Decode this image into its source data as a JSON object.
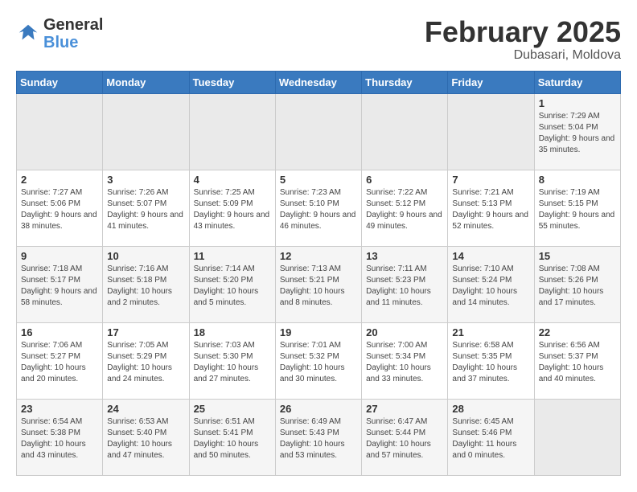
{
  "header": {
    "logo_line1": "General",
    "logo_line2": "Blue",
    "month_year": "February 2025",
    "location": "Dubasari, Moldova"
  },
  "weekdays": [
    "Sunday",
    "Monday",
    "Tuesday",
    "Wednesday",
    "Thursday",
    "Friday",
    "Saturday"
  ],
  "weeks": [
    [
      {
        "day": "",
        "info": ""
      },
      {
        "day": "",
        "info": ""
      },
      {
        "day": "",
        "info": ""
      },
      {
        "day": "",
        "info": ""
      },
      {
        "day": "",
        "info": ""
      },
      {
        "day": "",
        "info": ""
      },
      {
        "day": "1",
        "info": "Sunrise: 7:29 AM\nSunset: 5:04 PM\nDaylight: 9 hours and 35 minutes."
      }
    ],
    [
      {
        "day": "2",
        "info": "Sunrise: 7:27 AM\nSunset: 5:06 PM\nDaylight: 9 hours and 38 minutes."
      },
      {
        "day": "3",
        "info": "Sunrise: 7:26 AM\nSunset: 5:07 PM\nDaylight: 9 hours and 41 minutes."
      },
      {
        "day": "4",
        "info": "Sunrise: 7:25 AM\nSunset: 5:09 PM\nDaylight: 9 hours and 43 minutes."
      },
      {
        "day": "5",
        "info": "Sunrise: 7:23 AM\nSunset: 5:10 PM\nDaylight: 9 hours and 46 minutes."
      },
      {
        "day": "6",
        "info": "Sunrise: 7:22 AM\nSunset: 5:12 PM\nDaylight: 9 hours and 49 minutes."
      },
      {
        "day": "7",
        "info": "Sunrise: 7:21 AM\nSunset: 5:13 PM\nDaylight: 9 hours and 52 minutes."
      },
      {
        "day": "8",
        "info": "Sunrise: 7:19 AM\nSunset: 5:15 PM\nDaylight: 9 hours and 55 minutes."
      }
    ],
    [
      {
        "day": "9",
        "info": "Sunrise: 7:18 AM\nSunset: 5:17 PM\nDaylight: 9 hours and 58 minutes."
      },
      {
        "day": "10",
        "info": "Sunrise: 7:16 AM\nSunset: 5:18 PM\nDaylight: 10 hours and 2 minutes."
      },
      {
        "day": "11",
        "info": "Sunrise: 7:14 AM\nSunset: 5:20 PM\nDaylight: 10 hours and 5 minutes."
      },
      {
        "day": "12",
        "info": "Sunrise: 7:13 AM\nSunset: 5:21 PM\nDaylight: 10 hours and 8 minutes."
      },
      {
        "day": "13",
        "info": "Sunrise: 7:11 AM\nSunset: 5:23 PM\nDaylight: 10 hours and 11 minutes."
      },
      {
        "day": "14",
        "info": "Sunrise: 7:10 AM\nSunset: 5:24 PM\nDaylight: 10 hours and 14 minutes."
      },
      {
        "day": "15",
        "info": "Sunrise: 7:08 AM\nSunset: 5:26 PM\nDaylight: 10 hours and 17 minutes."
      }
    ],
    [
      {
        "day": "16",
        "info": "Sunrise: 7:06 AM\nSunset: 5:27 PM\nDaylight: 10 hours and 20 minutes."
      },
      {
        "day": "17",
        "info": "Sunrise: 7:05 AM\nSunset: 5:29 PM\nDaylight: 10 hours and 24 minutes."
      },
      {
        "day": "18",
        "info": "Sunrise: 7:03 AM\nSunset: 5:30 PM\nDaylight: 10 hours and 27 minutes."
      },
      {
        "day": "19",
        "info": "Sunrise: 7:01 AM\nSunset: 5:32 PM\nDaylight: 10 hours and 30 minutes."
      },
      {
        "day": "20",
        "info": "Sunrise: 7:00 AM\nSunset: 5:34 PM\nDaylight: 10 hours and 33 minutes."
      },
      {
        "day": "21",
        "info": "Sunrise: 6:58 AM\nSunset: 5:35 PM\nDaylight: 10 hours and 37 minutes."
      },
      {
        "day": "22",
        "info": "Sunrise: 6:56 AM\nSunset: 5:37 PM\nDaylight: 10 hours and 40 minutes."
      }
    ],
    [
      {
        "day": "23",
        "info": "Sunrise: 6:54 AM\nSunset: 5:38 PM\nDaylight: 10 hours and 43 minutes."
      },
      {
        "day": "24",
        "info": "Sunrise: 6:53 AM\nSunset: 5:40 PM\nDaylight: 10 hours and 47 minutes."
      },
      {
        "day": "25",
        "info": "Sunrise: 6:51 AM\nSunset: 5:41 PM\nDaylight: 10 hours and 50 minutes."
      },
      {
        "day": "26",
        "info": "Sunrise: 6:49 AM\nSunset: 5:43 PM\nDaylight: 10 hours and 53 minutes."
      },
      {
        "day": "27",
        "info": "Sunrise: 6:47 AM\nSunset: 5:44 PM\nDaylight: 10 hours and 57 minutes."
      },
      {
        "day": "28",
        "info": "Sunrise: 6:45 AM\nSunset: 5:46 PM\nDaylight: 11 hours and 0 minutes."
      },
      {
        "day": "",
        "info": ""
      }
    ]
  ]
}
